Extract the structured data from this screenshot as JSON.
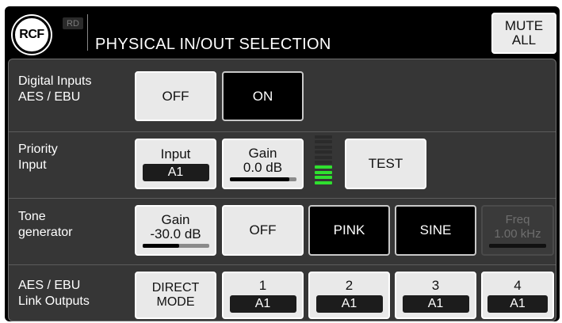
{
  "header": {
    "logo_text": "RCF",
    "badge": "RD",
    "title": "PHYSICAL IN/OUT SELECTION",
    "mute_all_line1": "MUTE",
    "mute_all_line2": "ALL"
  },
  "digital_inputs": {
    "label_line1": "Digital Inputs",
    "label_line2": "AES / EBU",
    "off_label": "OFF",
    "on_label": "ON",
    "selected": "ON"
  },
  "priority_input": {
    "label_line1": "Priority",
    "label_line2": "Input",
    "input_label": "Input",
    "input_value": "A1",
    "gain_label": "Gain",
    "gain_value": "0.0 dB",
    "gain_level_fraction": 0.9,
    "meter_level_segments_lit": 4,
    "meter_segments_total": 10,
    "test_label": "TEST"
  },
  "tone_generator": {
    "label_line1": "Tone",
    "label_line2": "generator",
    "gain_label": "Gain",
    "gain_value": "-30.0 dB",
    "gain_level_fraction": 0.55,
    "off_label": "OFF",
    "pink_label": "PINK",
    "sine_label": "SINE",
    "freq_label": "Freq",
    "freq_value": "1.00 kHz"
  },
  "link_outputs": {
    "label_line1": "AES / EBU",
    "label_line2": "Link Outputs",
    "direct_mode_line1": "DIRECT",
    "direct_mode_line2": "MODE",
    "outputs": [
      {
        "number": "1",
        "value": "A1"
      },
      {
        "number": "2",
        "value": "A1"
      },
      {
        "number": "3",
        "value": "A1"
      },
      {
        "number": "4",
        "value": "A1"
      }
    ]
  },
  "colors": {
    "meter_lit": "#2fe02f",
    "meter_unlit": "#2b2b2b",
    "panel_bg": "#363636"
  }
}
